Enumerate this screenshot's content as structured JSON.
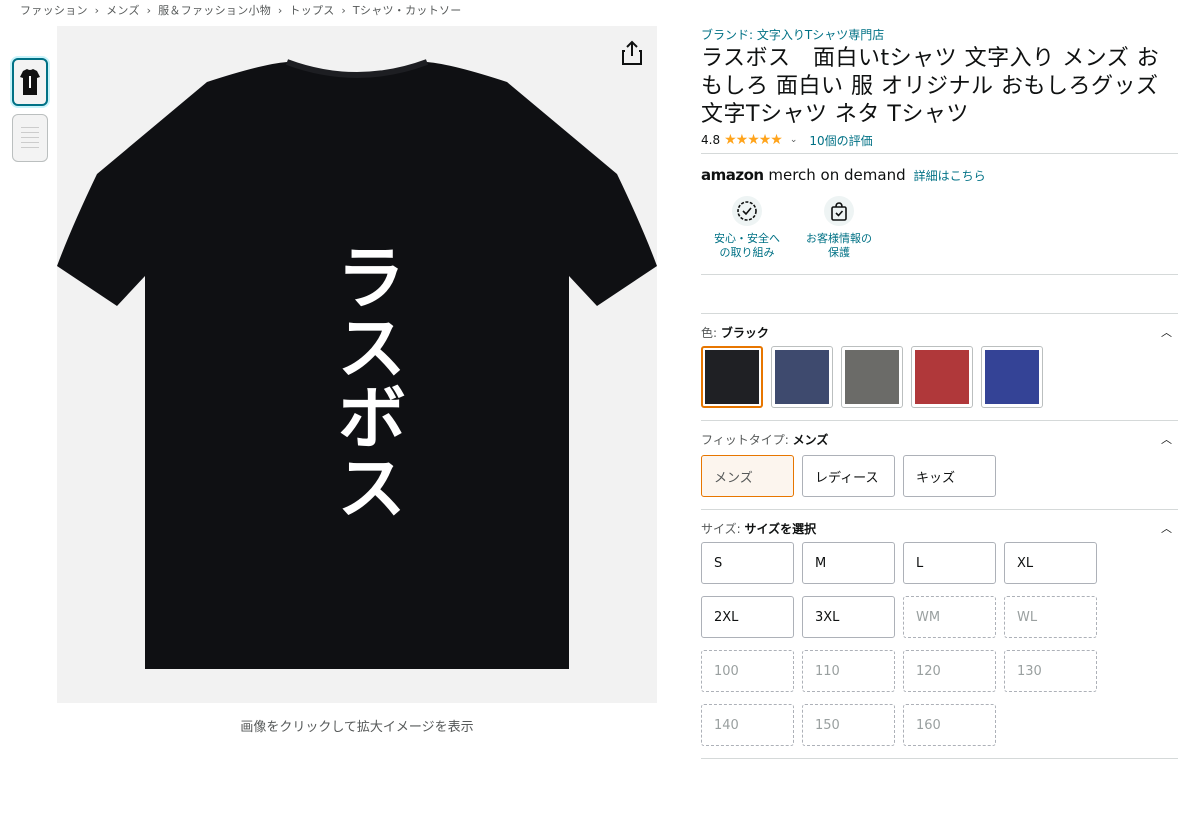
{
  "breadcrumb": [
    "ファッション",
    "›",
    "メンズ",
    "›",
    "服＆ファッション小物",
    "›",
    "トップス",
    "›",
    "Tシャツ・カットソー"
  ],
  "product_image": {
    "print_text": "ラスボス",
    "shirt_color": "#0f1013",
    "zoom_hint": "画像をクリックして拡大イメージを表示"
  },
  "brand_line": "ブランド: 文字入りTシャツ専門店",
  "title": "ラスボス　面白いtシャツ 文字入り メンズ おもしろ 面白い 服 オリジナル おもしろグッズ 文字Tシャツ ネタ Tシャツ",
  "rating": {
    "value": "4.8",
    "stars": "★★★★★",
    "reviews_link": "10個の評価"
  },
  "merch": {
    "logo_bold": "amazon",
    "logo_rest": " merch on demand",
    "link": "詳細はこちら"
  },
  "badges": [
    {
      "icon": "shield-check-icon",
      "label_line1": "安心・安全へ",
      "label_line2": "の取り組み"
    },
    {
      "icon": "lock-bag-icon",
      "label_line1": "お客様情報の",
      "label_line2": "保護"
    }
  ],
  "color_section": {
    "label": "色:",
    "selected": "ブラック",
    "swatches": [
      {
        "name": "ブラック",
        "hex": "#1f2024"
      },
      {
        "name": "ネイビー",
        "hex": "#3e4a6e"
      },
      {
        "name": "グレー",
        "hex": "#6b6b68"
      },
      {
        "name": "レッド",
        "hex": "#b0383a"
      },
      {
        "name": "ブルー",
        "hex": "#344396"
      }
    ]
  },
  "fit_section": {
    "label": "フィットタイプ:",
    "selected": "メンズ",
    "options": [
      "メンズ",
      "レディース",
      "キッズ"
    ]
  },
  "size_section": {
    "label": "サイズ:",
    "selected": "サイズを選択",
    "available": [
      "S",
      "M",
      "L",
      "XL",
      "2XL",
      "3XL"
    ],
    "unavailable": [
      "WM",
      "WL",
      "100",
      "110",
      "120",
      "130",
      "140",
      "150",
      "160"
    ]
  },
  "colors": {
    "link": "#007185",
    "star": "#ffa41c",
    "selected_border": "#e77600"
  }
}
